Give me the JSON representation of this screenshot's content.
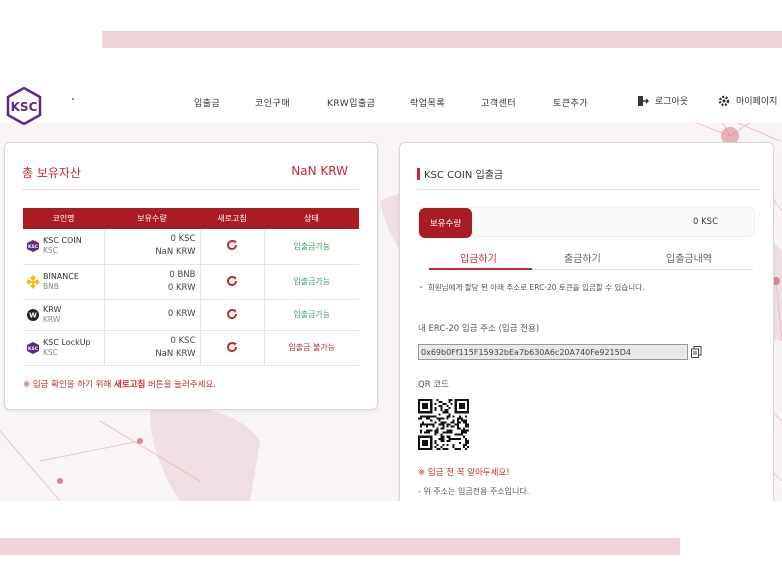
{
  "nav": {
    "logo_text": "KSC",
    "menu": [
      "입출금",
      "코인구매",
      "KRW입출금",
      "락업목록",
      "고객센터",
      "토큰추가"
    ],
    "logout_label": "로그아웃",
    "mypage_label": "마이페이지"
  },
  "assets": {
    "title": "총 보유자산",
    "total": "NaN KRW",
    "columns": [
      "코인명",
      "보유수량",
      "새로고침",
      "상태"
    ],
    "rows": [
      {
        "name": "KSC COIN",
        "symbol": "KSC",
        "icon": "ksc-logo-icon",
        "amount1": "0 KSC",
        "amount2": "NaN KRW",
        "status": "입출금가능"
      },
      {
        "name": "BINANCE",
        "symbol": "BNB",
        "icon": "binance-icon",
        "amount1": "0 BNB",
        "amount2": "0 KRW",
        "status": "입출금가능"
      },
      {
        "name": "KRW",
        "symbol": "KRW",
        "icon": "won-icon",
        "amount1": "0 KRW",
        "amount2": "",
        "status": "입출금가능"
      },
      {
        "name": "KSC LockUp",
        "symbol": "KSC",
        "icon": "ksc-logo-icon",
        "amount1": "0 KSC",
        "amount2": "NaN KRW",
        "status": "입출금 불가능"
      }
    ],
    "note_prefix": "※ 입금 확인을 하기 위해 ",
    "note_bold": "새로고침",
    "note_suffix": " 버튼을 눌러주세요."
  },
  "deposit": {
    "title": "KSC COIN 입출금",
    "holding_label": "보유수량",
    "holding_value": "0 KSC",
    "tabs": [
      "입금하기",
      "출금하기",
      "입출금내역"
    ],
    "active_tab": "입금하기",
    "info": "회원님에게 할당 된 아래 주소로 ERC-20 토큰을 입금할 수 있습니다.",
    "address_label": "내 ERC-20 입금 주소 (입금 전용)",
    "address": "0x69b0Ff115F15932bEa7b630A6c20A740Fe9215D4",
    "qr_label": "QR 코드",
    "warning": "※ 입금 전 꼭 알아두세요!",
    "warning_item": "- 위 주소는 입금전용 주소입니다."
  },
  "colors": {
    "accent": "#c22b33",
    "header_red": "#a81c22",
    "ok_green": "#3da35d",
    "brand_purple": "#5b2a86",
    "deco_pink": "#eed3d8"
  }
}
